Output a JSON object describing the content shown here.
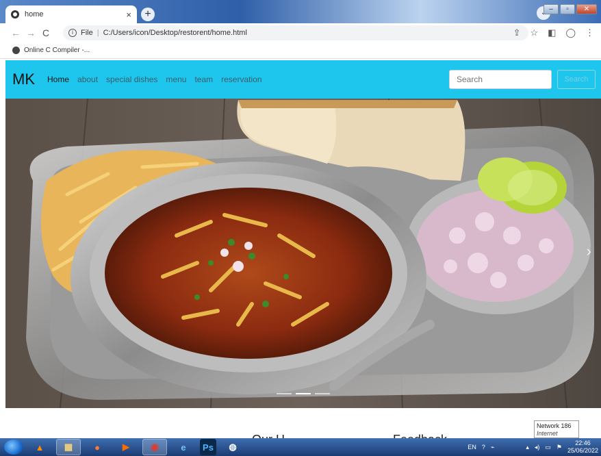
{
  "browser": {
    "tab_title": "home",
    "tab_close": "×",
    "new_tab": "+",
    "url_label": "File",
    "url_path": "C:/Users/icon/Desktop/restorent/home.html",
    "bookmark": "Online C Compiler -..."
  },
  "site": {
    "brand": "MK",
    "nav": [
      "Home",
      "about",
      "special dishes",
      "menu",
      "team",
      "reservation"
    ],
    "search_placeholder": "Search",
    "search_button": "Search",
    "below_left": "Our H",
    "below_right": "Feedback"
  },
  "tooltip": {
    "line1": "Network 186",
    "line2": "Internet access"
  },
  "taskbar": {
    "lang": "EN",
    "time": "22:46",
    "date": "25/06/2022"
  },
  "colors": {
    "nav_bg": "#1ec6ee",
    "taskbar": "#2a5090"
  }
}
